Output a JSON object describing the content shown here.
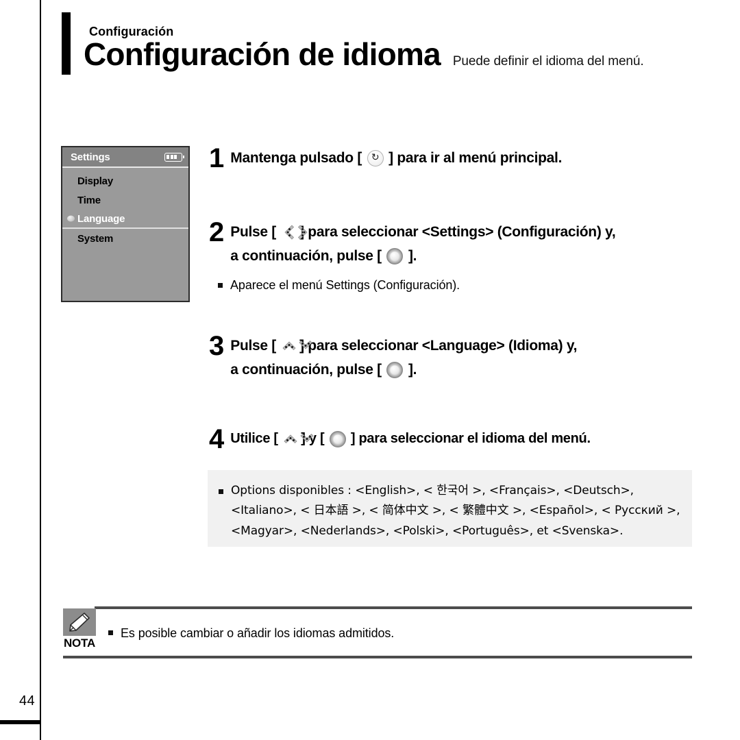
{
  "header": {
    "eyebrow": "Configuración",
    "title": "Configuración de idioma",
    "subtitle": "Puede definir el idioma del menú."
  },
  "device_screen": {
    "title": "Settings",
    "battery_icon": "battery-full-icon",
    "items": [
      {
        "label": "Display",
        "selected": false
      },
      {
        "label": "Time",
        "selected": false
      },
      {
        "label": "Language",
        "selected": true
      },
      {
        "label": "System",
        "selected": false
      }
    ]
  },
  "steps": [
    {
      "number": "1",
      "lines": [
        {
          "before": "Mantenga pulsado [ ",
          "icon": "return-icon",
          "after": " ] para ir al menú principal."
        }
      ]
    },
    {
      "number": "2",
      "lines": [
        {
          "before": "Pulse [ ",
          "icon": "left-right-chevron-icon",
          "after": " ] para seleccionar <Settings> (Configuración) y,"
        },
        {
          "before": "a continuación, pulse [ ",
          "icon": "select-button-icon",
          "after": " ]."
        }
      ]
    },
    {
      "number": "3",
      "lines": [
        {
          "before": "Pulse [ ",
          "icon": "up-down-chevron-icon",
          "after": " ] para seleccionar <Language> (Idioma) y,"
        },
        {
          "before": "a continuación, pulse [ ",
          "icon": "select-button-icon",
          "after": " ]."
        }
      ]
    },
    {
      "number": "4",
      "lines": [
        {
          "before": "Utilice [ ",
          "icon": "up-down-chevron-icon",
          "mid": " ] y [ ",
          "icon2": "select-button-icon",
          "after": " ] para seleccionar el idioma del menú."
        }
      ]
    }
  ],
  "bullets": {
    "after_step2": "Aparece el menú Settings (Configuración)."
  },
  "options_box": {
    "line1": "Options disponibles : <English>, < 한국어 >, <Français>, <Deutsch>,",
    "line2": "<Italiano>, < 日本語 >, < 简体中文 >, < 繁體中文 >,  <Español>, < Русский >,",
    "line3": "<Magyar>, <Nederlands>, <Polski>, <Português>, et <Svenska>."
  },
  "note": {
    "badge_label": "NOTA",
    "badge_icon": "pencil-icon",
    "text": "Es posible cambiar o añadir los idiomas admitidos."
  },
  "footer": {
    "page_number": "44"
  },
  "colors": {
    "device_body": "#9a9a9a",
    "device_titlebar": "#838383",
    "options_box_bg": "#f1f1f1",
    "note_badge_bg": "#8c8c8c",
    "rule": "#4d4d4d"
  }
}
